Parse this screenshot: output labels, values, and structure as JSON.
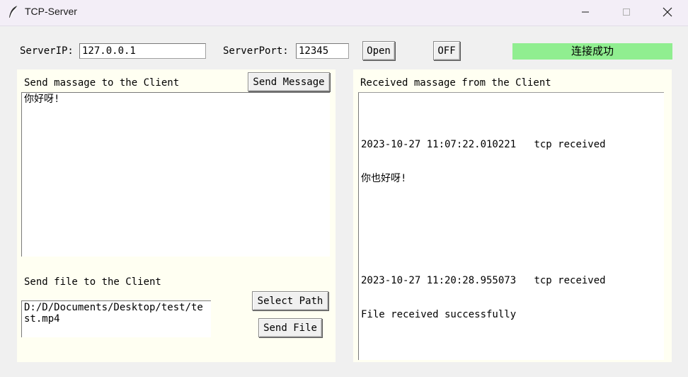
{
  "window": {
    "title": "TCP-Server",
    "icon": "feather-icon",
    "minimize_icon": "minimize-icon",
    "maximize_icon": "maximize-icon",
    "close_icon": "close-icon"
  },
  "connection": {
    "ip_label": "ServerIP:",
    "ip_value": "127.0.0.1",
    "port_label": "ServerPort:",
    "port_value": "12345",
    "open_label": "Open",
    "off_label": "OFF",
    "status_text": "连接成功",
    "status_color": "#90ee90"
  },
  "send_message": {
    "heading": "Send massage to the Client",
    "button_label": "Send Message",
    "text": "你好呀!"
  },
  "send_file": {
    "heading": "Send file to the Client",
    "path_text": "D:/D/Documents/Desktop/test/test.mp4",
    "select_path_label": "Select Path",
    "send_file_label": "Send File"
  },
  "received": {
    "heading": "Received massage from the Client",
    "entries": [
      {
        "timestamp": "2023-10-27 11:07:22.010221",
        "kind": "tcp received",
        "message": "你也好呀!"
      },
      {
        "timestamp": "2023-10-27 11:20:28.955073",
        "kind": "tcp received",
        "message": "File received successfully"
      }
    ]
  },
  "colors": {
    "panel_bg": "#fffff2",
    "window_bg": "#f0f0f0",
    "titlebar_bg": "#f3eef7"
  }
}
